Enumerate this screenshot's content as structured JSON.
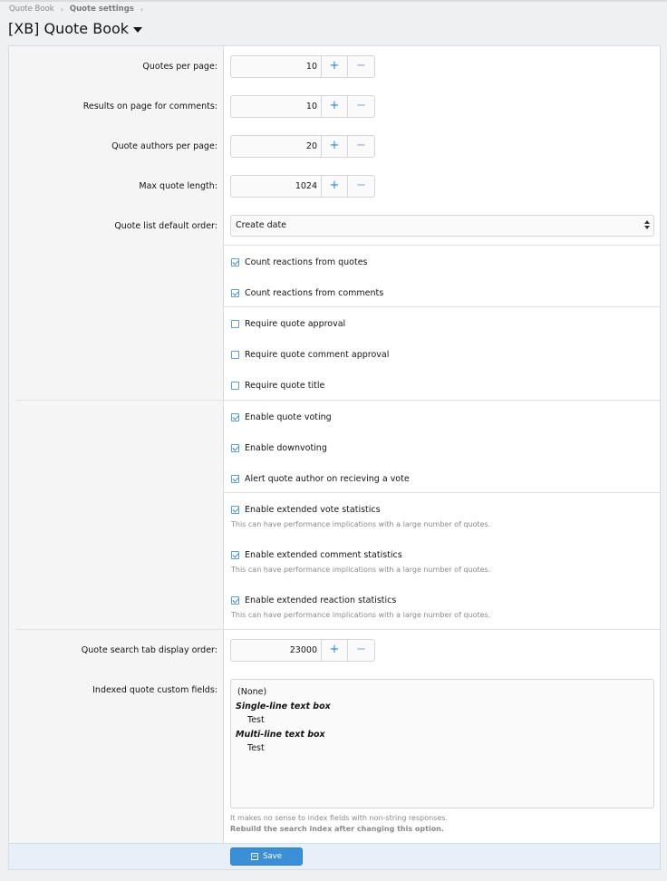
{
  "breadcrumb": [
    "Quote Book",
    "Quote settings"
  ],
  "page_title": "[XB] Quote Book",
  "fields": {
    "quotes_per_page": {
      "label": "Quotes per page:",
      "value": "10"
    },
    "results_comments": {
      "label": "Results on page for comments:",
      "value": "10"
    },
    "authors_per_page": {
      "label": "Quote authors per page:",
      "value": "20"
    },
    "max_length": {
      "label": "Max quote length:",
      "value": "1024"
    },
    "default_order": {
      "label": "Quote list default order:",
      "selected": "Create date"
    },
    "search_tab_order": {
      "label": "Quote search tab display order:",
      "value": "23000"
    },
    "indexed_fields": {
      "label": "Indexed quote custom fields:",
      "options": [
        "(None)",
        "Single-line text box",
        "Test",
        "Multi-line text box",
        "Test"
      ],
      "explain": "It makes no sense to index fields with non-string responses.",
      "explain_bold": "Rebuild the search index after changing this option."
    }
  },
  "checkboxes": {
    "count_reactions_quotes": {
      "label": "Count reactions from quotes",
      "checked": true
    },
    "count_reactions_comments": {
      "label": "Count reactions from comments",
      "checked": true
    },
    "require_quote_approval": {
      "label": "Require quote approval",
      "checked": false
    },
    "require_comment_approval": {
      "label": "Require quote comment approval",
      "checked": false
    },
    "require_quote_title": {
      "label": "Require quote title",
      "checked": false
    },
    "enable_voting": {
      "label": "Enable quote voting",
      "checked": true
    },
    "enable_downvoting": {
      "label": "Enable downvoting",
      "checked": true
    },
    "alert_author_vote": {
      "label": "Alert quote author on recieving a vote",
      "checked": true
    },
    "ext_vote_stats": {
      "label": "Enable extended vote statistics",
      "checked": true,
      "hint": "This can have performance implications with a large number of quotes."
    },
    "ext_comment_stats": {
      "label": "Enable extended comment statistics",
      "checked": true,
      "hint": "This can have performance implications with a large number of quotes."
    },
    "ext_reaction_stats": {
      "label": "Enable extended reaction statistics",
      "checked": true,
      "hint": "This can have performance implications with a large number of quotes."
    }
  },
  "stepper": {
    "plus": "+",
    "minus": "−"
  },
  "save_label": "Save",
  "colors": {
    "accent": "#2f87cc",
    "button": "#3b8fd6",
    "footer": "#e7f0f8"
  }
}
